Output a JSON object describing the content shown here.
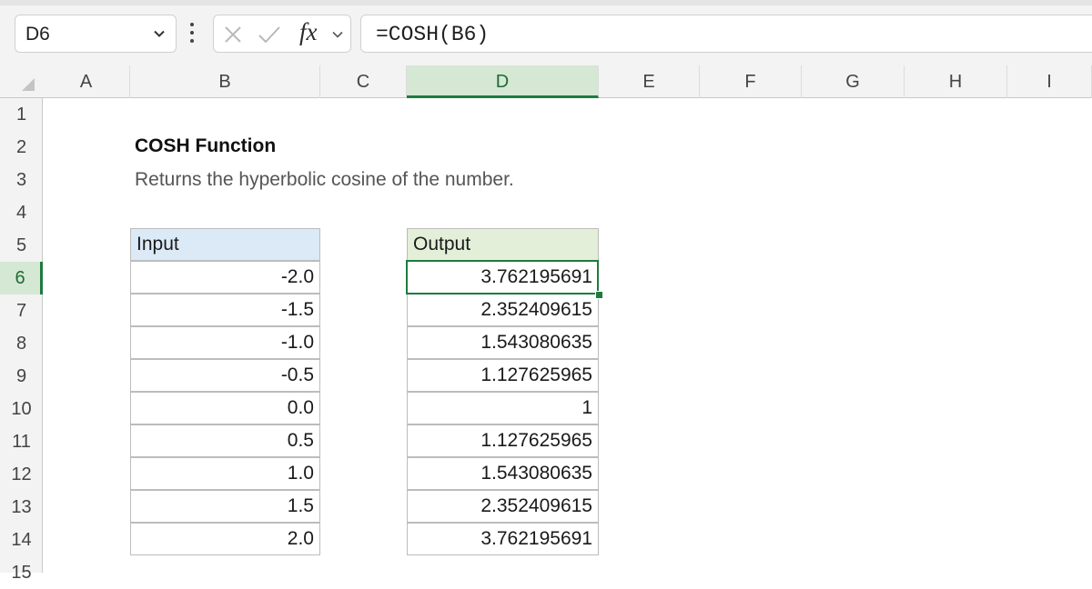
{
  "formula_bar": {
    "name_box": "D6",
    "fx_label": "fx",
    "formula": "=COSH(B6)"
  },
  "columns": [
    "A",
    "B",
    "C",
    "D",
    "E",
    "F",
    "G",
    "H",
    "I"
  ],
  "selected_column": "D",
  "rows": [
    "1",
    "2",
    "3",
    "4",
    "5",
    "6",
    "7",
    "8",
    "9",
    "10",
    "11",
    "12",
    "13",
    "14",
    "15"
  ],
  "selected_row": "6",
  "sheet": {
    "title": "COSH Function",
    "subtitle": "Returns the hyperbolic cosine of the number.",
    "input_header": "Input",
    "output_header": "Output",
    "inputs": [
      "-2.0",
      "-1.5",
      "-1.0",
      "-0.5",
      "0.0",
      "0.5",
      "1.0",
      "1.5",
      "2.0"
    ],
    "outputs": [
      "3.762195691",
      "2.352409615",
      "1.543080635",
      "1.127625965",
      "1",
      "1.127625965",
      "1.543080635",
      "2.352409615",
      "3.762195691"
    ]
  },
  "colors": {
    "selection_green": "#1f7a3f",
    "input_header_bg": "#dce9f7",
    "output_header_bg": "#e3efd8"
  }
}
